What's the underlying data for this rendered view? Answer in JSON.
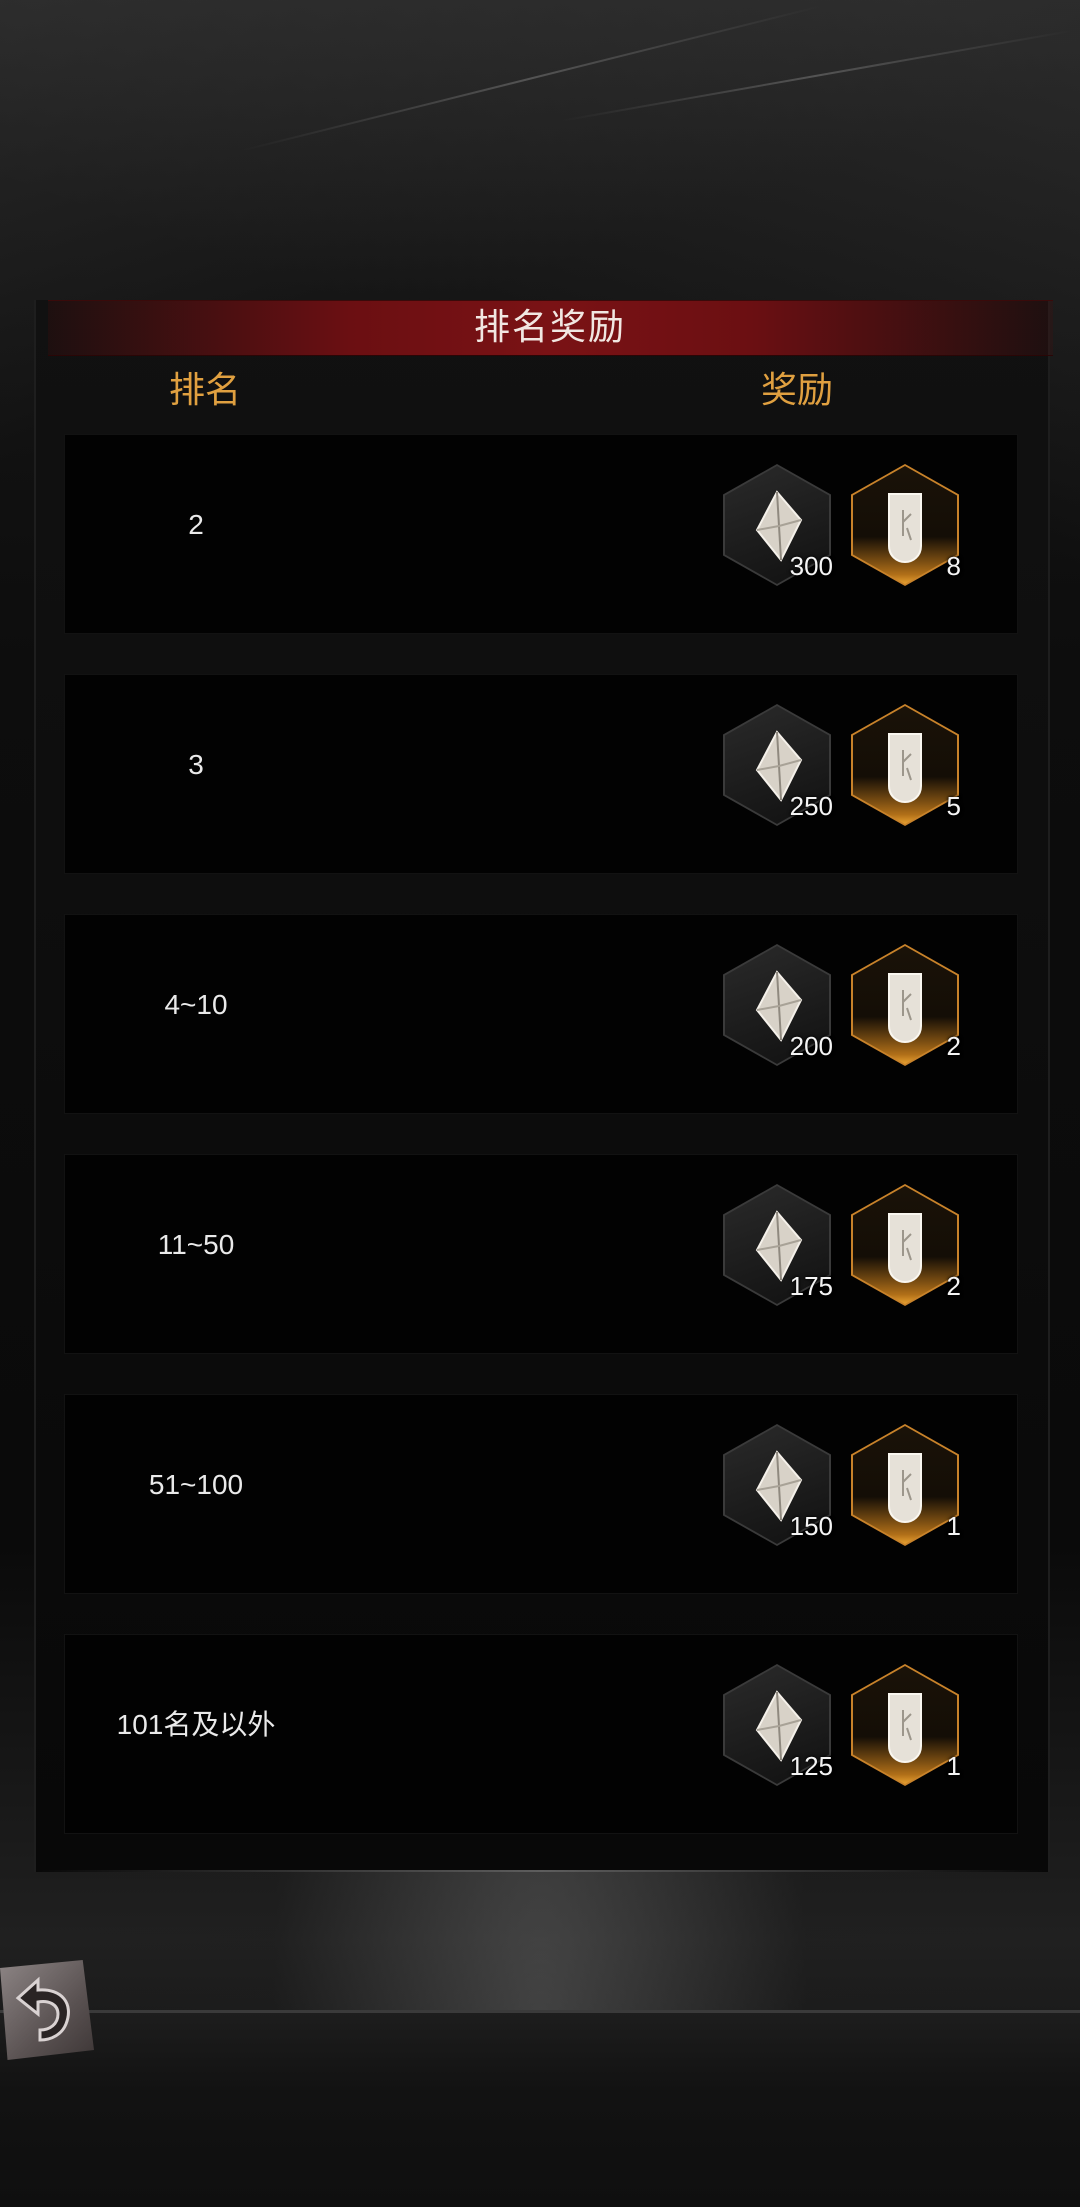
{
  "header": {
    "title": "排名奖励"
  },
  "columns": {
    "rank": "排名",
    "reward": "奖励"
  },
  "rows": [
    {
      "rank": "2",
      "rewards": [
        {
          "item": "crystal-icon",
          "qty": "300"
        },
        {
          "item": "rune-token-icon",
          "qty": "8"
        }
      ]
    },
    {
      "rank": "3",
      "rewards": [
        {
          "item": "crystal-icon",
          "qty": "250"
        },
        {
          "item": "rune-token-icon",
          "qty": "5"
        }
      ]
    },
    {
      "rank": "4~10",
      "rewards": [
        {
          "item": "crystal-icon",
          "qty": "200"
        },
        {
          "item": "rune-token-icon",
          "qty": "2"
        }
      ]
    },
    {
      "rank": "11~50",
      "rewards": [
        {
          "item": "crystal-icon",
          "qty": "175"
        },
        {
          "item": "rune-token-icon",
          "qty": "2"
        }
      ]
    },
    {
      "rank": "51~100",
      "rewards": [
        {
          "item": "crystal-icon",
          "qty": "150"
        },
        {
          "item": "rune-token-icon",
          "qty": "1"
        }
      ]
    },
    {
      "rank": "101名及以外",
      "rewards": [
        {
          "item": "crystal-icon",
          "qty": "125"
        },
        {
          "item": "rune-token-icon",
          "qty": "1"
        }
      ]
    }
  ],
  "colors": {
    "title_bar": "#6b0f12",
    "header_text": "#e0a040",
    "gold_frame": "#c8822a"
  }
}
